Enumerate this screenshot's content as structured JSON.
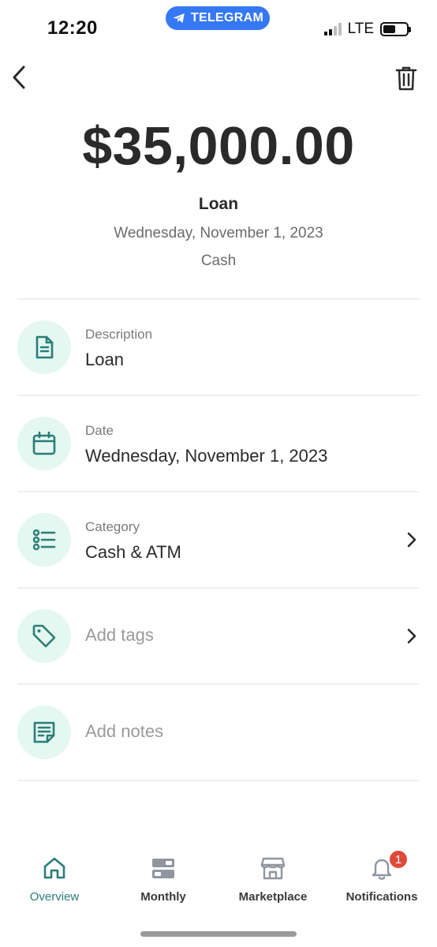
{
  "status_bar": {
    "time": "12:20",
    "telegram_label": "TELEGRAM",
    "network": "LTE"
  },
  "nav": {
    "back_icon": "chevron-left-icon",
    "delete_icon": "trash-icon"
  },
  "transaction": {
    "amount": "$35,000.00",
    "name": "Loan",
    "date": "Wednesday, November 1, 2023",
    "account": "Cash"
  },
  "details": {
    "description": {
      "label": "Description",
      "value": "Loan",
      "icon": "document-icon"
    },
    "date": {
      "label": "Date",
      "value": "Wednesday, November 1, 2023",
      "icon": "calendar-icon"
    },
    "category": {
      "label": "Category",
      "value": "Cash & ATM",
      "icon": "list-icon"
    },
    "tags": {
      "value": "Add tags",
      "icon": "tag-icon"
    },
    "notes": {
      "value": "Add notes",
      "icon": "notes-icon"
    }
  },
  "tabbar": {
    "tabs": [
      {
        "label": "Overview",
        "icon": "home-icon",
        "active": true
      },
      {
        "label": "Monthly",
        "icon": "monthly-icon",
        "active": false
      },
      {
        "label": "Marketplace",
        "icon": "store-icon",
        "active": false
      },
      {
        "label": "Notifications",
        "icon": "bell-icon",
        "active": false,
        "badge": "1"
      }
    ]
  },
  "colors": {
    "accent": "#2b7d78",
    "icon_bg": "#e4f7f1",
    "telegram_blue": "#3478f6",
    "badge_red": "#e04a3a"
  }
}
